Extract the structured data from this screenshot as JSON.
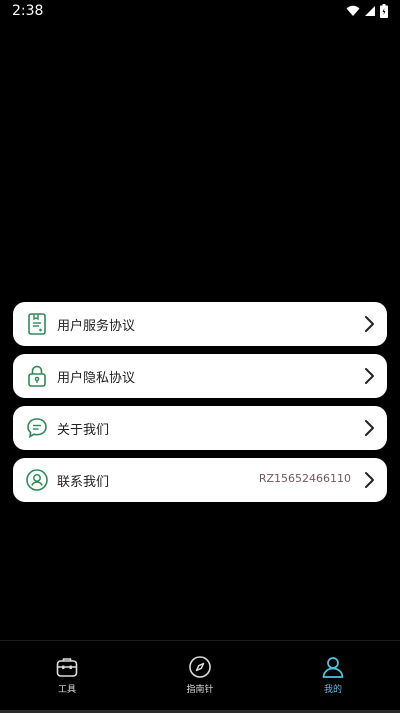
{
  "status": {
    "time": "2:38"
  },
  "menu": [
    {
      "label": "用户服务协议",
      "value": ""
    },
    {
      "label": "用户隐私协议",
      "value": ""
    },
    {
      "label": "关于我们",
      "value": ""
    },
    {
      "label": "联系我们",
      "value": "RZ15652466110"
    }
  ],
  "tabs": [
    {
      "label": "工具",
      "icon": "toolbox-icon"
    },
    {
      "label": "指南针",
      "icon": "compass-icon"
    },
    {
      "label": "我的",
      "icon": "profile-icon",
      "active": true
    }
  ],
  "colors": {
    "accent": "#49c6e5",
    "icon_green": "#2e8b57",
    "background": "#000000",
    "card": "#ffffff"
  }
}
